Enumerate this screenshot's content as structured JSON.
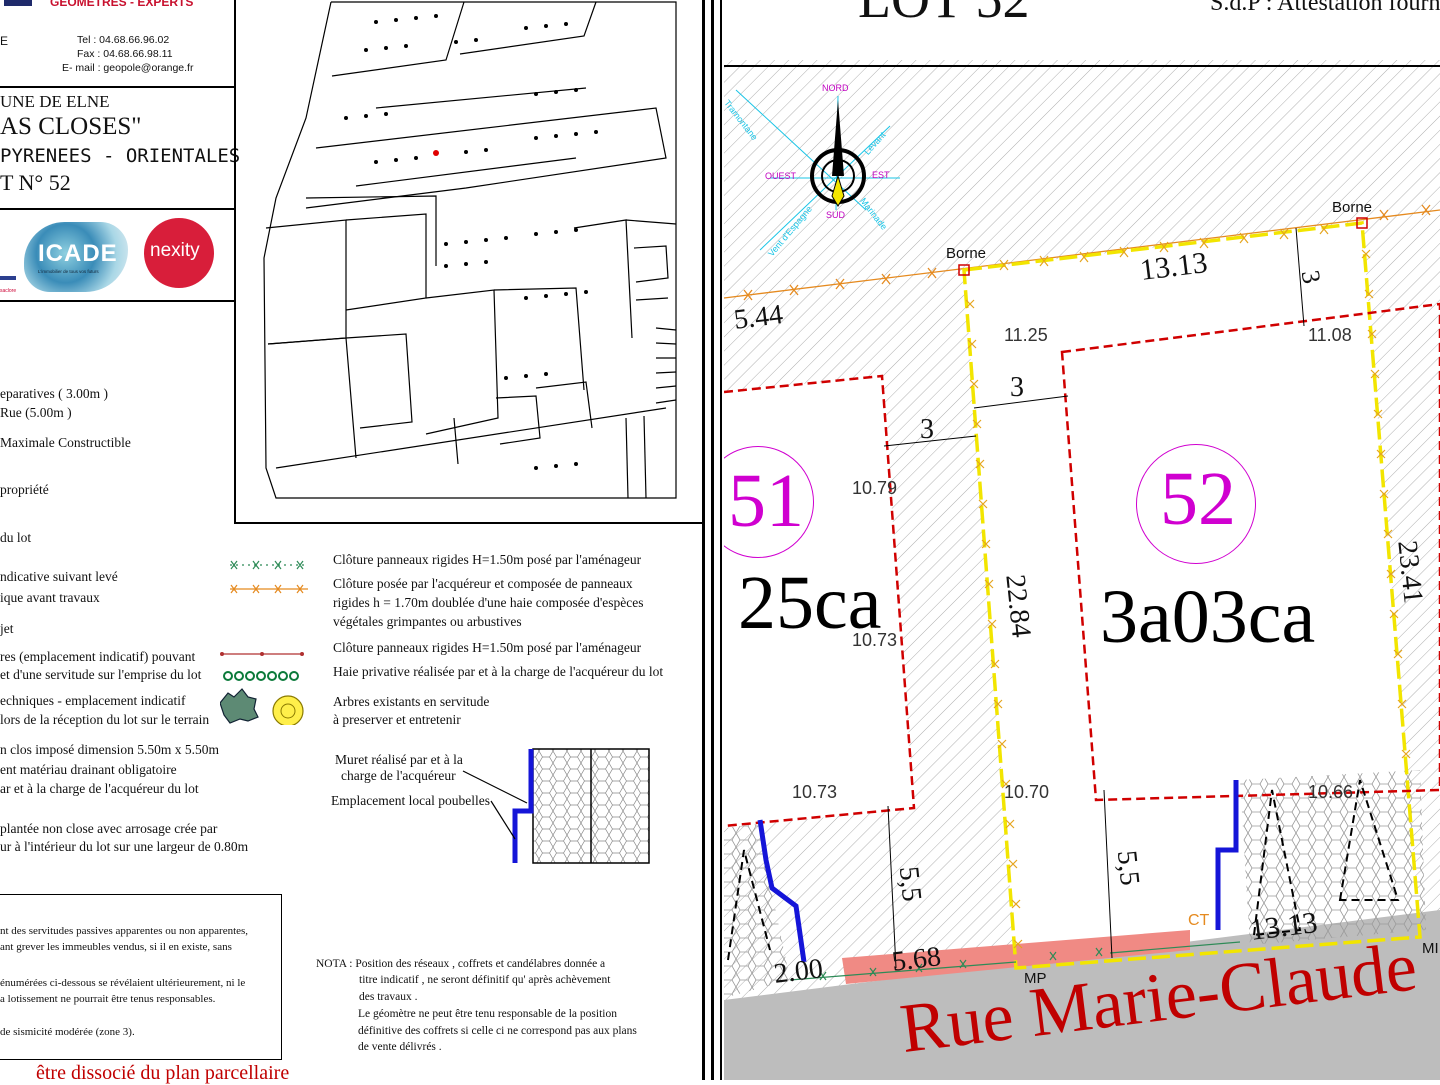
{
  "header": {
    "company": "GEOMETRES - EXPERTS",
    "company_letter": "E",
    "tel": "Tel : 04.68.66.96.02",
    "fax": "Fax : 04.68.66.98.11",
    "email": "E- mail : geopole@orange.fr",
    "commune": "UNE DE ELNE",
    "lieu": "AS CLOSES\"",
    "dept": "PYRENEES - ORIENTALES",
    "lot": "T N° 52"
  },
  "logos": {
    "icade": "ICADE",
    "icade_sub": "L'immobilier de tous vos futurs",
    "nexity": "nexity",
    "small": "saclore"
  },
  "left_legend": [
    "eparatives ( 3.00m )",
    "Rue (5.00m )",
    "Maximale Constructible",
    "propriété",
    "du lot",
    "ndicative suivant levé",
    "ique avant travaux",
    "jet",
    "res (emplacement indicatif) pouvant",
    "et d'une servitude sur l'emprise du lot",
    "echniques - emplacement indicatif",
    "lors de la réception du lot sur le terrain",
    "n clos imposé dimension 5.50m  x 5.50m",
    "ent matériau drainant obligatoire",
    "ar et à la charge de l'acquéreur du lot",
    "plantée non close avec arrosage crée par",
    "ur à l'intérieur du lot sur une largeur de 0.80m"
  ],
  "right_legend": {
    "cloture_1": "Clôture panneaux rigides H=1.50m posé par l'aménageur",
    "cloture_2a": "Clôture posée par l'acquéreur et composée de panneaux",
    "cloture_2b": "rigides h = 1.70m doublée d'une haie composée d'espèces",
    "cloture_2c": "végétales grimpantes ou arbustives",
    "cloture_3": "Clôture panneaux rigides H=1.50m posé par l'aménageur",
    "haie": "Haie privative réalisée par et à la charge de l'acquéreur du lot",
    "arbres_a": "Arbres existants en servitude",
    "arbres_b": "à preserver et entretenir",
    "muret_a": "Muret réalisé par et à la",
    "muret_b": "charge de l'acquéreur",
    "poubelles": "Emplacement local poubelles"
  },
  "servitudes": {
    "l1": "nt des servitudes passives apparentes ou non apparentes,",
    "l2": "ant grever les immeubles vendus, si il en existe, sans",
    "l3": "énumérées ci-dessous se révélaient ultérieurement, ni le",
    "l4": "a lotissement ne pourrait être tenus responsables.",
    "l5": "de sismicité modérée (zone 3)."
  },
  "nota": {
    "l1": "NOTA : Position des réseaux , coffrets et candélabres donnée a",
    "l2": "titre indicatif , ne seront définitif qu' après achèvement",
    "l3": "des travaux .",
    "l4": "Le géomètre ne peut être tenu responsable de la position",
    "l5": "définitive des coffrets si celle ci ne correspond pas aux plans",
    "l6": "de vente délivrés ."
  },
  "bottom_red": "être dissocié du plan parcellaire",
  "plan": {
    "title": "LOT 52",
    "sdp": "S.d.P : Attestation fourn",
    "lot_number": "52",
    "lot_area": "3a03ca",
    "neighbor_number": "51",
    "neighbor_area": "25ca",
    "street": "Rue Marie-Claude",
    "borne_left": "Borne",
    "borne_right": "Borne",
    "compass": {
      "nord": "NORD",
      "sud": "SUD",
      "est": "EST",
      "ouest": "OUEST",
      "tramontane": "Tramontane",
      "levant": "Levant",
      "marinade": "Marinade",
      "vent": "Vent d'Espagne"
    },
    "dims": {
      "top": "13.13",
      "top_left_edge": "5.44",
      "right_side": "23.41",
      "left_side": "22.84",
      "bottom": "13.13",
      "setback_top": "3",
      "setback_left": "3",
      "setback_51": "3",
      "front_left": "5,5",
      "front_right": "5,5",
      "corner_tl": "11.25",
      "corner_tr": "11.08",
      "corner_bl": "10.70",
      "corner_br": "10.66",
      "n51_top": "10.79",
      "n51_mid": "10.73",
      "n51_bl": "10.73",
      "frontage_a": "5.68",
      "frontage_b": "2.00",
      "mp": "MP",
      "mp_right": "MI",
      "ct": "CT"
    }
  }
}
